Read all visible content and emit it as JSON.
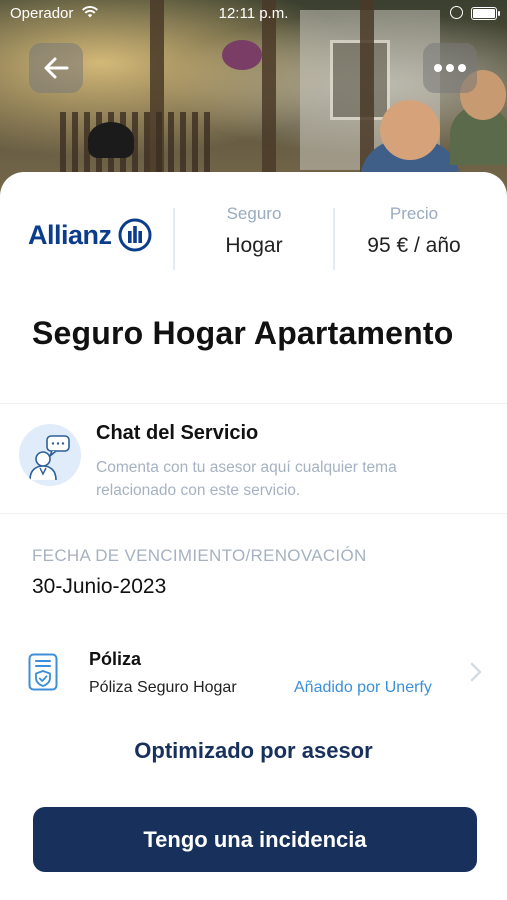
{
  "status_bar": {
    "carrier": "Operador",
    "time": "12:11 p.m."
  },
  "header": {
    "back_icon": "arrow-left-icon",
    "more_icon": "more-horizontal-icon"
  },
  "summary": {
    "brand": "Allianz",
    "brand_icon": "allianz-logo-icon",
    "insurance_label": "Seguro",
    "insurance_value": "Hogar",
    "price_label": "Precio",
    "price_value": "95 € / año"
  },
  "title": "Seguro Hogar Apartamento",
  "chat": {
    "icon": "advisor-chat-icon",
    "title": "Chat del Servicio",
    "description": "Comenta con tu asesor aquí cualquier tema relacionado con este servicio."
  },
  "due": {
    "label": "FECHA DE VENCIMIENTO/RENOVACIÓN",
    "value": "30-Junio-2023"
  },
  "policy": {
    "icon": "policy-document-icon",
    "title": "Póliza",
    "subtitle": "Póliza Seguro Hogar",
    "added_by": "Añadido por Unerfy",
    "chevron_icon": "chevron-right-icon"
  },
  "optimized_label": "Optimizado por asesor",
  "cta_label": "Tengo una incidencia",
  "colors": {
    "primary": "#17305c",
    "brand_blue": "#0b3d8c",
    "link": "#3b8fd9",
    "muted": "#a6b2c2"
  }
}
